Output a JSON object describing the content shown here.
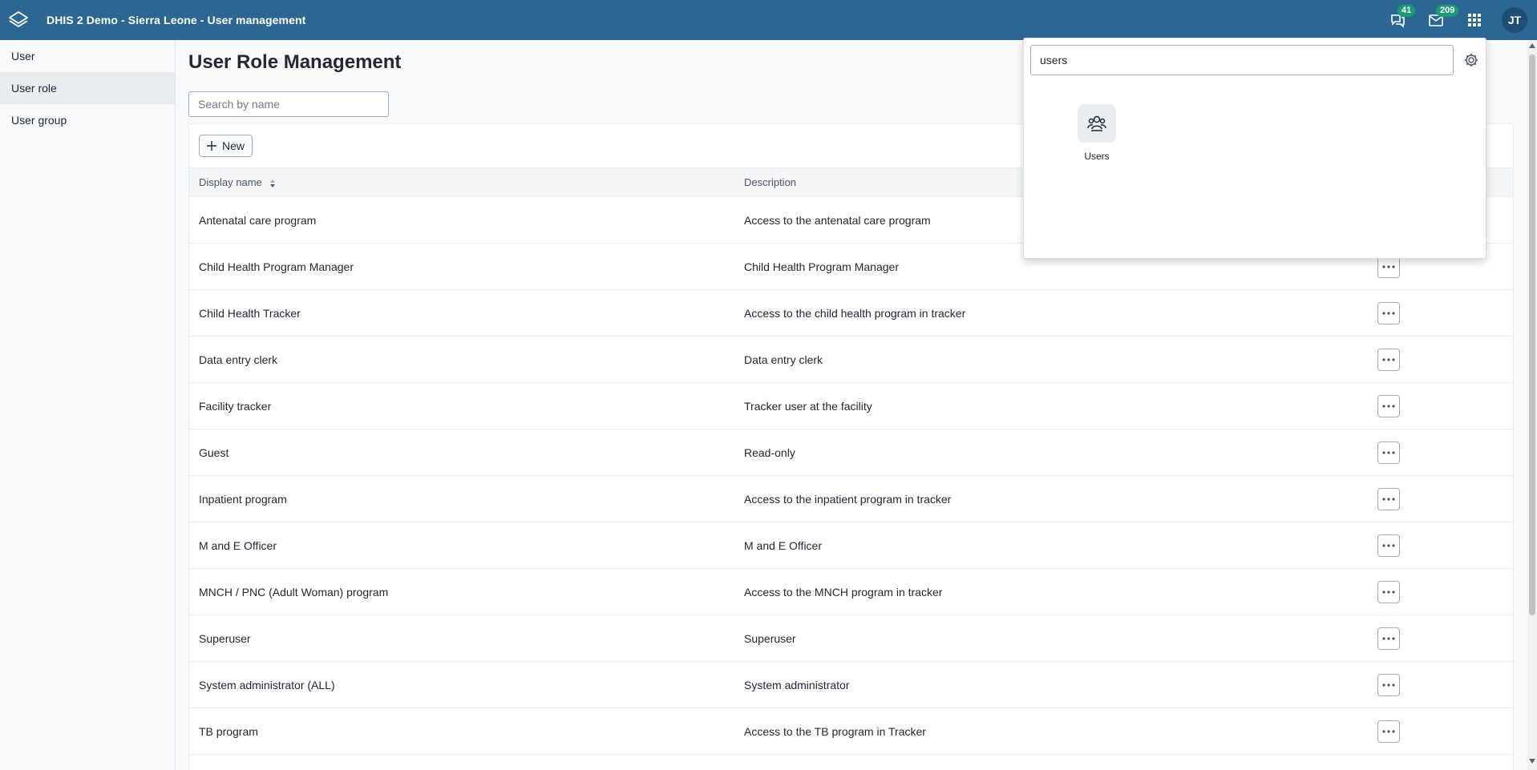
{
  "header": {
    "title": "DHIS 2 Demo - Sierra Leone - User management",
    "logo_icon": "dhis2-logo-icon",
    "interpretations_count": "41",
    "messages_count": "209",
    "avatar_initials": "JT",
    "color": "#2c6693"
  },
  "sidebar": {
    "items": [
      {
        "label": "User"
      },
      {
        "label": "User role"
      },
      {
        "label": "User group"
      }
    ],
    "active": "User role"
  },
  "main": {
    "title": "User Role Management",
    "search_placeholder": "Search by name",
    "new_label": "New",
    "columns": {
      "name": "Display name",
      "description": "Description"
    },
    "rows": [
      {
        "name": "Antenatal care program",
        "description": "Access to the antenatal care program"
      },
      {
        "name": "Child Health Program Manager",
        "description": "Child Health Program Manager"
      },
      {
        "name": "Child Health Tracker",
        "description": "Access to the child health program in tracker"
      },
      {
        "name": "Data entry clerk",
        "description": "Data entry clerk"
      },
      {
        "name": "Facility tracker",
        "description": "Tracker user at the facility"
      },
      {
        "name": "Guest",
        "description": "Read-only"
      },
      {
        "name": "Inpatient program",
        "description": "Access to the inpatient program in tracker"
      },
      {
        "name": "M and E Officer",
        "description": "M and E Officer"
      },
      {
        "name": "MNCH / PNC (Adult Woman) program",
        "description": "Access to the MNCH program in tracker"
      },
      {
        "name": "Superuser",
        "description": "Superuser"
      },
      {
        "name": "System administrator (ALL)",
        "description": "System administrator"
      },
      {
        "name": "TB program",
        "description": "Access to the TB program in Tracker"
      }
    ]
  },
  "palette": {
    "query": "users",
    "results": [
      {
        "label": "Users",
        "icon": "users-icon"
      }
    ]
  }
}
